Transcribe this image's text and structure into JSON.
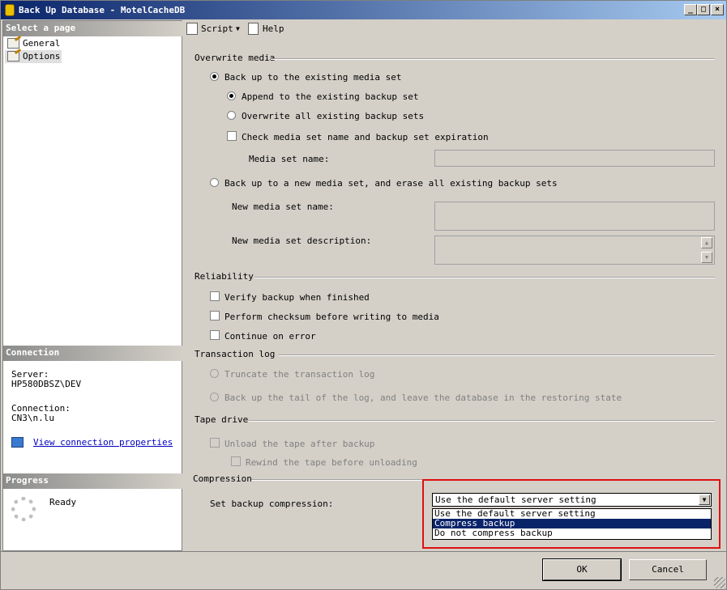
{
  "window": {
    "title": "Back Up Database - MotelCacheDB"
  },
  "left_panel": {
    "select_page_header": "Select a page",
    "pages": [
      {
        "label": "General"
      },
      {
        "label": "Options"
      }
    ],
    "connection_header": "Connection",
    "server_label": "Server:",
    "server_value": "HP580DBSZ\\DEV",
    "connection_label": "Connection:",
    "connection_value": "CN3\\n.lu",
    "view_props_link": "View connection properties",
    "progress_header": "Progress",
    "progress_status": "Ready"
  },
  "toolbar": {
    "script_label": "Script",
    "help_label": "Help"
  },
  "overwrite": {
    "title": "Overwrite media",
    "backup_existing": "Back up to the existing media set",
    "append": "Append to the existing backup set",
    "overwrite_all": "Overwrite all existing backup sets",
    "check_media": "Check media set name and backup set expiration",
    "media_set_name": "Media set name:",
    "backup_new": "Back up to a new media set, and erase all existing backup sets",
    "new_media_name": "New media set name:",
    "new_media_desc": "New media set description:"
  },
  "reliability": {
    "title": "Reliability",
    "verify": "Verify backup when finished",
    "checksum": "Perform checksum before writing to media",
    "continue": "Continue on error"
  },
  "translog": {
    "title": "Transaction log",
    "truncate": "Truncate the transaction log",
    "tail": "Back up the tail of the log, and leave the database in the restoring state"
  },
  "tape": {
    "title": "Tape drive",
    "unload": "Unload the tape after backup",
    "rewind": "Rewind the tape before unloading"
  },
  "compression": {
    "title": "Compression",
    "label": "Set backup compression:",
    "selected": "Use the default server setting",
    "options": [
      "Use the default server setting",
      "Compress backup",
      "Do not compress backup"
    ],
    "highlighted_index": 1
  },
  "buttons": {
    "ok": "OK",
    "cancel": "Cancel"
  },
  "colors": {
    "highlight": "#0a246a",
    "annotation_box": "#e01010"
  }
}
